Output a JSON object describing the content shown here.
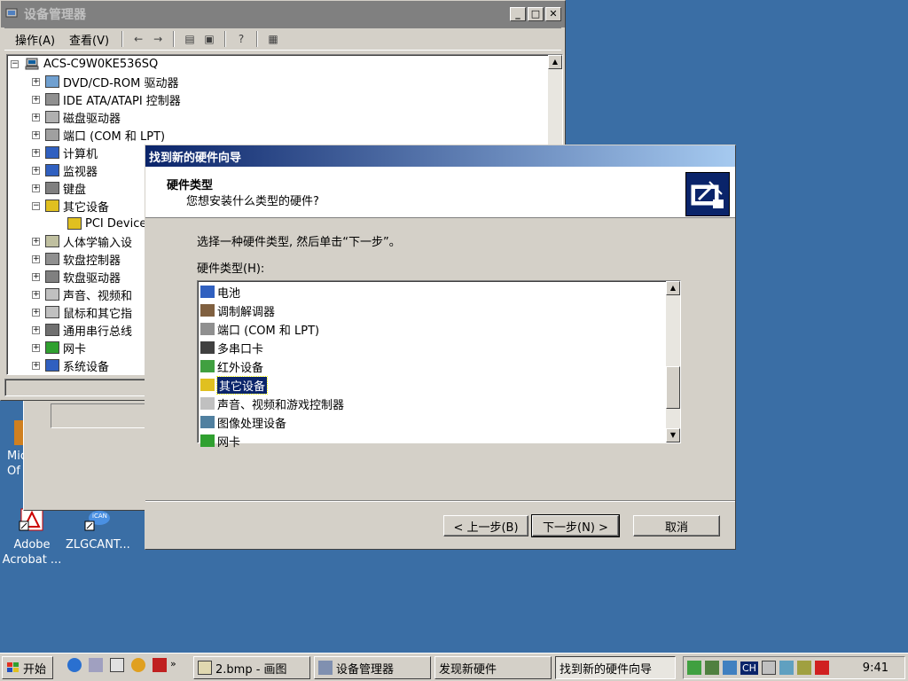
{
  "devmgr": {
    "title": "设备管理器",
    "menu": [
      "操作(A)",
      "查看(V)"
    ],
    "root": "ACS-C9W0KE536SQ",
    "items": [
      "DVD/CD-ROM 驱动器",
      "IDE ATA/ATAPI 控制器",
      "磁盘驱动器",
      "端口 (COM 和 LPT)",
      "计算机",
      "监视器",
      "键盘",
      "其它设备",
      "PCI Device",
      "人体学输入设",
      "软盘控制器",
      "软盘驱动器",
      "声音、视频和",
      "鼠标和其它指",
      "通用串行总线",
      "网卡",
      "系统设备"
    ]
  },
  "desktop": {
    "icons": [
      {
        "label1": "Mic",
        "label2": "Of"
      },
      {
        "label1": "Adobe",
        "label2": "Acrobat ..."
      },
      {
        "label1": "ZLGCANT...",
        "label2": ""
      }
    ]
  },
  "wizard": {
    "title": "找到新的硬件向导",
    "header_title": "硬件类型",
    "header_subtitle": "您想安装什么类型的硬件?",
    "instruction": "选择一种硬件类型, 然后单击“下一步”。",
    "list_label": "硬件类型(H):",
    "list_items": [
      "电池",
      "调制解调器",
      "端口 (COM 和 LPT)",
      "多串口卡",
      "红外设备",
      "其它设备",
      "声音、视频和游戏控制器",
      "图像处理设备",
      "网卡"
    ],
    "selected_index": 5,
    "back_label": "< 上一步(B)",
    "next_label": "下一步(N) >",
    "cancel_label": "取消"
  },
  "taskbar": {
    "start_label": "开始",
    "tasks": [
      "2.bmp - 画图",
      "设备管理器",
      "发现新硬件",
      "找到新的硬件向导"
    ],
    "active_task": 3,
    "tray_lang": "CH",
    "clock": "9:41"
  }
}
